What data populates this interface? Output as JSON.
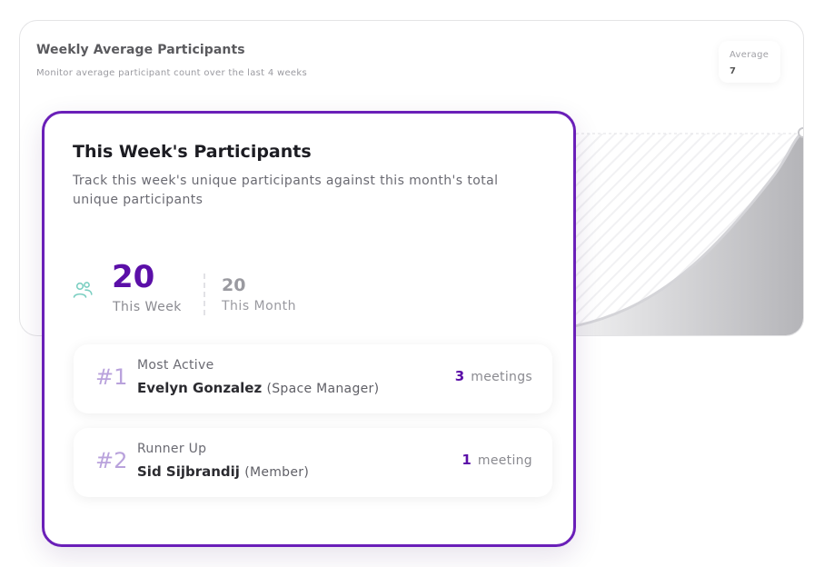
{
  "background_panel": {
    "title": "Weekly Average Participants",
    "subtitle": "Monitor average participant count over the last 4 weeks",
    "average_label": "Average",
    "average_value": "7"
  },
  "participants_card": {
    "title": "This Week's Participants",
    "description": "Track this week's unique participants against this month's total unique participants",
    "this_week_value": "20",
    "this_week_label": "This Week",
    "this_month_value": "20",
    "this_month_label": "This Month",
    "icon": "people-icon",
    "rankings": [
      {
        "rank": "#1",
        "label": "Most Active",
        "name": "Evelyn Gonzalez",
        "role": "(Space Manager)",
        "count": "3",
        "unit": "meetings"
      },
      {
        "rank": "#2",
        "label": "Runner Up",
        "name": "Sid Sijbrandij",
        "role": "(Member)",
        "count": "1",
        "unit": "meeting"
      }
    ]
  },
  "colors": {
    "accent_purple": "#5b0fa8",
    "card_border": "#6a1fb8",
    "rank_hash": "#b9a2dc"
  }
}
